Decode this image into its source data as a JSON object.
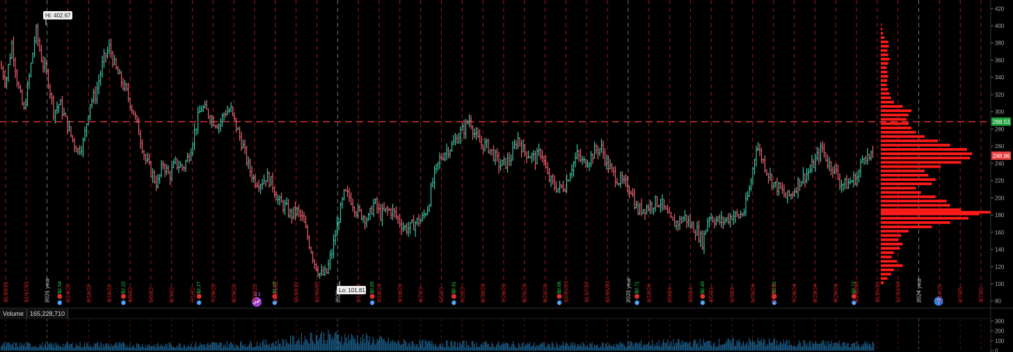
{
  "chart_data": [
    {
      "type": "ohlc",
      "title": "",
      "price_axis": {
        "min": 80,
        "max": 420,
        "ticks": [
          80,
          100,
          120,
          140,
          160,
          180,
          200,
          220,
          240,
          260,
          280,
          300,
          320,
          340,
          360,
          380,
          400,
          420
        ]
      },
      "high_label": "Hi: 402.67",
      "low_label": "Lo: 101.81",
      "last_price": "288.53",
      "last_price_color": "#1fa23b",
      "prev_marker": "248.96",
      "prev_marker_color": "#e84040",
      "current_line_value": 288.53,
      "colors": {
        "up": "#3cc9a8",
        "down": "#f06070",
        "grid_red": "#a01818",
        "profile": "#ff1a1a",
        "background": "#000000"
      },
      "price_path": [
        [
          0,
          355
        ],
        [
          0.15,
          335
        ],
        [
          0.3,
          380
        ],
        [
          0.45,
          330
        ],
        [
          0.6,
          300
        ],
        [
          0.75,
          345
        ],
        [
          0.9,
          395
        ],
        [
          1.05,
          360
        ],
        [
          1.2,
          340
        ],
        [
          1.35,
          300
        ],
        [
          1.5,
          310
        ],
        [
          1.65,
          290
        ],
        [
          1.8,
          270
        ],
        [
          1.95,
          255
        ],
        [
          2.1,
          265
        ],
        [
          2.25,
          310
        ],
        [
          2.4,
          320
        ],
        [
          2.6,
          360
        ],
        [
          2.75,
          375
        ],
        [
          2.9,
          350
        ],
        [
          3.05,
          335
        ],
        [
          3.2,
          320
        ],
        [
          3.35,
          300
        ],
        [
          3.5,
          275
        ],
        [
          3.65,
          245
        ],
        [
          3.8,
          230
        ],
        [
          3.95,
          215
        ],
        [
          4.1,
          240
        ],
        [
          4.25,
          225
        ],
        [
          4.4,
          240
        ],
        [
          4.6,
          235
        ],
        [
          4.75,
          250
        ],
        [
          4.9,
          280
        ],
        [
          5.05,
          305
        ],
        [
          5.2,
          300
        ],
        [
          5.35,
          290
        ],
        [
          5.5,
          285
        ],
        [
          5.65,
          300
        ],
        [
          5.8,
          302
        ],
        [
          5.95,
          280
        ],
        [
          6.1,
          260
        ],
        [
          6.25,
          235
        ],
        [
          6.4,
          220
        ],
        [
          6.55,
          218
        ],
        [
          6.7,
          225
        ],
        [
          6.85,
          215
        ],
        [
          7.0,
          195
        ],
        [
          7.15,
          190
        ],
        [
          7.3,
          180
        ],
        [
          7.45,
          185
        ],
        [
          7.6,
          175
        ],
        [
          7.75,
          150
        ],
        [
          7.9,
          125
        ],
        [
          8.05,
          110
        ],
        [
          8.2,
          112
        ],
        [
          8.35,
          140
        ],
        [
          8.5,
          175
        ],
        [
          8.65,
          205
        ],
        [
          8.8,
          200
        ],
        [
          8.95,
          185
        ],
        [
          9.1,
          180
        ],
        [
          9.25,
          175
        ],
        [
          9.4,
          195
        ],
        [
          9.55,
          180
        ],
        [
          9.7,
          185
        ],
        [
          9.85,
          185
        ],
        [
          10.0,
          175
        ],
        [
          10.15,
          165
        ],
        [
          10.3,
          165
        ],
        [
          10.45,
          172
        ],
        [
          10.6,
          175
        ],
        [
          10.75,
          190
        ],
        [
          10.9,
          225
        ],
        [
          11.05,
          245
        ],
        [
          11.2,
          255
        ],
        [
          11.35,
          260
        ],
        [
          11.5,
          272
        ],
        [
          11.65,
          280
        ],
        [
          11.8,
          292
        ],
        [
          11.95,
          270
        ],
        [
          12.1,
          262
        ],
        [
          12.25,
          260
        ],
        [
          12.4,
          250
        ],
        [
          12.55,
          238
        ],
        [
          12.7,
          240
        ],
        [
          12.85,
          248
        ],
        [
          13.0,
          270
        ],
        [
          13.15,
          255
        ],
        [
          13.3,
          250
        ],
        [
          13.45,
          245
        ],
        [
          13.6,
          255
        ],
        [
          13.75,
          225
        ],
        [
          13.9,
          215
        ],
        [
          14.05,
          210
        ],
        [
          14.2,
          215
        ],
        [
          14.35,
          235
        ],
        [
          14.5,
          250
        ],
        [
          14.65,
          240
        ],
        [
          14.8,
          245
        ],
        [
          14.95,
          255
        ],
        [
          15.1,
          258
        ],
        [
          15.25,
          240
        ],
        [
          15.4,
          228
        ],
        [
          15.55,
          220
        ],
        [
          15.7,
          215
        ],
        [
          15.85,
          210
        ],
        [
          16.0,
          185
        ],
        [
          16.15,
          188
        ],
        [
          16.3,
          190
        ],
        [
          16.45,
          195
        ],
        [
          16.6,
          195
        ],
        [
          16.75,
          180
        ],
        [
          16.9,
          170
        ],
        [
          17.05,
          172
        ],
        [
          17.2,
          178
        ],
        [
          17.35,
          168
        ],
        [
          17.5,
          162
        ],
        [
          17.65,
          148
        ],
        [
          17.8,
          180
        ],
        [
          17.95,
          175
        ],
        [
          18.1,
          172
        ],
        [
          18.25,
          175
        ],
        [
          18.4,
          180
        ],
        [
          18.55,
          178
        ],
        [
          18.7,
          185
        ],
        [
          18.85,
          215
        ],
        [
          19.0,
          262
        ],
        [
          19.15,
          245
        ],
        [
          19.3,
          228
        ],
        [
          19.45,
          215
        ],
        [
          19.6,
          210
        ],
        [
          19.75,
          200
        ],
        [
          19.9,
          205
        ],
        [
          20.05,
          218
        ],
        [
          20.2,
          225
        ],
        [
          20.35,
          232
        ],
        [
          20.5,
          245
        ],
        [
          20.65,
          258
        ],
        [
          20.8,
          240
        ],
        [
          20.95,
          235
        ],
        [
          21.1,
          218
        ],
        [
          21.25,
          215
        ],
        [
          21.4,
          220
        ],
        [
          21.55,
          225
        ],
        [
          21.7,
          252
        ],
        [
          21.85,
          245
        ],
        [
          21.95,
          248.96
        ]
      ],
      "x_labels": [
        "11/19/21",
        "12/17/21",
        "2021 year",
        "1/14/22",
        "2/11/22",
        "3/11/22",
        "4/8/22",
        "5/6/22",
        "6/3/22",
        "7/1/22",
        "7/29/22",
        "8/26/22",
        "9/23/22",
        "10/21/22",
        "11/18/22",
        "12/16/22",
        "2022",
        "1/13/23",
        "2/10/23",
        "3/10/23",
        "4/7/23",
        "5/5/23",
        "6/2/23",
        "6/30/23",
        "7/28/23",
        "8/25/23",
        "9/22/23",
        "10/20/23",
        "11/17/23",
        "12/15/23",
        "2023 year",
        "1/12/24",
        "2/9/24",
        "3/8/24",
        "4/5/24",
        "5/3/24",
        "5/31/24",
        "6/28/24",
        "7/26/24",
        "8/23/24",
        "9/20/24",
        "10/18/24",
        "11/15/24",
        "12/13/24",
        "2024 year",
        "1/10/25",
        "2/7/25",
        "3/7/25"
      ],
      "events": [
        {
          "x": 1.5,
          "label": "$2.54"
        },
        {
          "x": 3.1,
          "label": "$2.22"
        },
        {
          "x": 5.0,
          "label": "$2.27"
        },
        {
          "x": 6.45,
          "label": "3:1",
          "split": true
        },
        {
          "x": 6.9,
          "label": "$1.05"
        },
        {
          "x": 9.35,
          "label": "$0.65"
        },
        {
          "x": 11.4,
          "label": "$0.91"
        },
        {
          "x": 14.05,
          "label": "$0.66"
        },
        {
          "x": 16.0,
          "label": "$0.71"
        },
        {
          "x": 17.65,
          "label": "$0.43"
        },
        {
          "x": 19.45,
          "label": "$0.52"
        },
        {
          "x": 21.45,
          "label": "$0.72"
        }
      ],
      "info_icon": "question-icon",
      "volume_profile": [
        [
          100,
          4
        ],
        [
          105,
          9
        ],
        [
          110,
          14
        ],
        [
          115,
          18
        ],
        [
          120,
          30
        ],
        [
          125,
          22
        ],
        [
          130,
          15
        ],
        [
          135,
          18
        ],
        [
          140,
          26
        ],
        [
          145,
          30
        ],
        [
          150,
          24
        ],
        [
          155,
          28
        ],
        [
          160,
          38
        ],
        [
          165,
          70
        ],
        [
          170,
          95
        ],
        [
          175,
          120
        ],
        [
          180,
          135
        ],
        [
          182,
          150
        ],
        [
          185,
          110
        ],
        [
          190,
          95
        ],
        [
          195,
          90
        ],
        [
          200,
          75
        ],
        [
          205,
          55
        ],
        [
          210,
          48
        ],
        [
          215,
          70
        ],
        [
          220,
          75
        ],
        [
          225,
          65
        ],
        [
          230,
          60
        ],
        [
          235,
          82
        ],
        [
          240,
          110
        ],
        [
          245,
          122
        ],
        [
          250,
          125
        ],
        [
          255,
          118
        ],
        [
          260,
          95
        ],
        [
          265,
          78
        ],
        [
          270,
          60
        ],
        [
          275,
          48
        ],
        [
          280,
          42
        ],
        [
          285,
          38
        ],
        [
          290,
          35
        ],
        [
          295,
          38
        ],
        [
          300,
          42
        ],
        [
          305,
          30
        ],
        [
          310,
          18
        ],
        [
          315,
          14
        ],
        [
          320,
          12
        ],
        [
          325,
          10
        ],
        [
          330,
          8
        ],
        [
          335,
          9
        ],
        [
          340,
          10
        ],
        [
          345,
          9
        ],
        [
          350,
          8
        ],
        [
          355,
          10
        ],
        [
          360,
          12
        ],
        [
          365,
          10
        ],
        [
          370,
          9
        ],
        [
          375,
          11
        ],
        [
          380,
          10
        ],
        [
          385,
          5
        ],
        [
          390,
          3
        ],
        [
          395,
          2
        ],
        [
          400,
          1
        ]
      ]
    },
    {
      "type": "bar",
      "title": "Volume",
      "value_label": "165,228,710",
      "y_ticks": [
        0,
        100,
        200,
        300
      ],
      "ylim": [
        0,
        310
      ],
      "bar_color": "#1f6c9e",
      "level_path": [
        [
          0,
          60
        ],
        [
          1,
          55
        ],
        [
          2,
          60
        ],
        [
          3,
          58
        ],
        [
          4,
          52
        ],
        [
          5,
          60
        ],
        [
          6,
          65
        ],
        [
          7,
          80
        ],
        [
          8,
          145
        ],
        [
          9,
          120
        ],
        [
          10,
          80
        ],
        [
          11,
          70
        ],
        [
          12,
          65
        ],
        [
          13,
          60
        ],
        [
          14,
          58
        ],
        [
          15,
          55
        ],
        [
          16,
          70
        ],
        [
          17,
          78
        ],
        [
          18,
          80
        ],
        [
          19,
          90
        ],
        [
          20,
          72
        ],
        [
          21,
          70
        ],
        [
          21.95,
          65
        ]
      ]
    }
  ]
}
